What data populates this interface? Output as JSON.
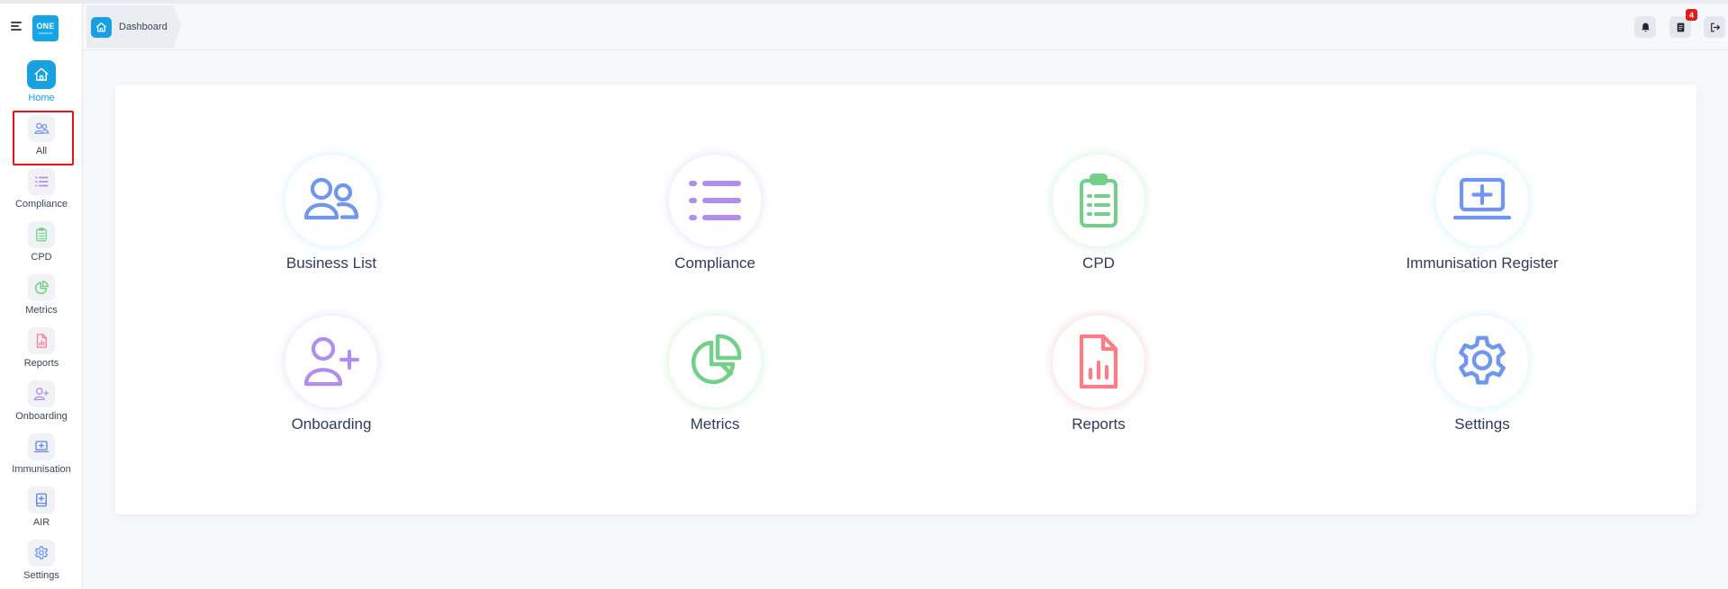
{
  "app": {
    "logo_text": "ONE",
    "logo_subtext": "PASSPORT"
  },
  "colors": {
    "accent": "#18a0e0",
    "highlight": "#e4141b",
    "blue": "#6f97f2",
    "purple": "#b08ef0",
    "green": "#73cf8a",
    "red": "#ff7c87"
  },
  "sidebar": {
    "items": [
      {
        "label": "Home",
        "icon": "home-icon"
      },
      {
        "label": "All",
        "icon": "users-icon"
      },
      {
        "label": "Compliance",
        "icon": "list-icon"
      },
      {
        "label": "CPD",
        "icon": "clipboard-icon"
      },
      {
        "label": "Metrics",
        "icon": "pie-chart-icon"
      },
      {
        "label": "Reports",
        "icon": "report-file-icon"
      },
      {
        "label": "Onboarding",
        "icon": "user-plus-icon"
      },
      {
        "label": "Immunisation",
        "icon": "laptop-plus-icon"
      },
      {
        "label": "AIR",
        "icon": "document-plus-icon"
      },
      {
        "label": "Settings",
        "icon": "gear-icon"
      }
    ],
    "active": "Home",
    "highlighted": "All"
  },
  "header": {
    "breadcrumb": "Dashboard",
    "notification_count": "4"
  },
  "tiles": [
    {
      "label": "Business List",
      "icon": "users-icon"
    },
    {
      "label": "Compliance",
      "icon": "list-icon"
    },
    {
      "label": "CPD",
      "icon": "clipboard-icon"
    },
    {
      "label": "Immunisation Register",
      "icon": "laptop-plus-icon"
    },
    {
      "label": "Onboarding",
      "icon": "user-plus-icon"
    },
    {
      "label": "Metrics",
      "icon": "pie-chart-icon"
    },
    {
      "label": "Reports",
      "icon": "report-file-icon"
    },
    {
      "label": "Settings",
      "icon": "gear-icon"
    }
  ]
}
